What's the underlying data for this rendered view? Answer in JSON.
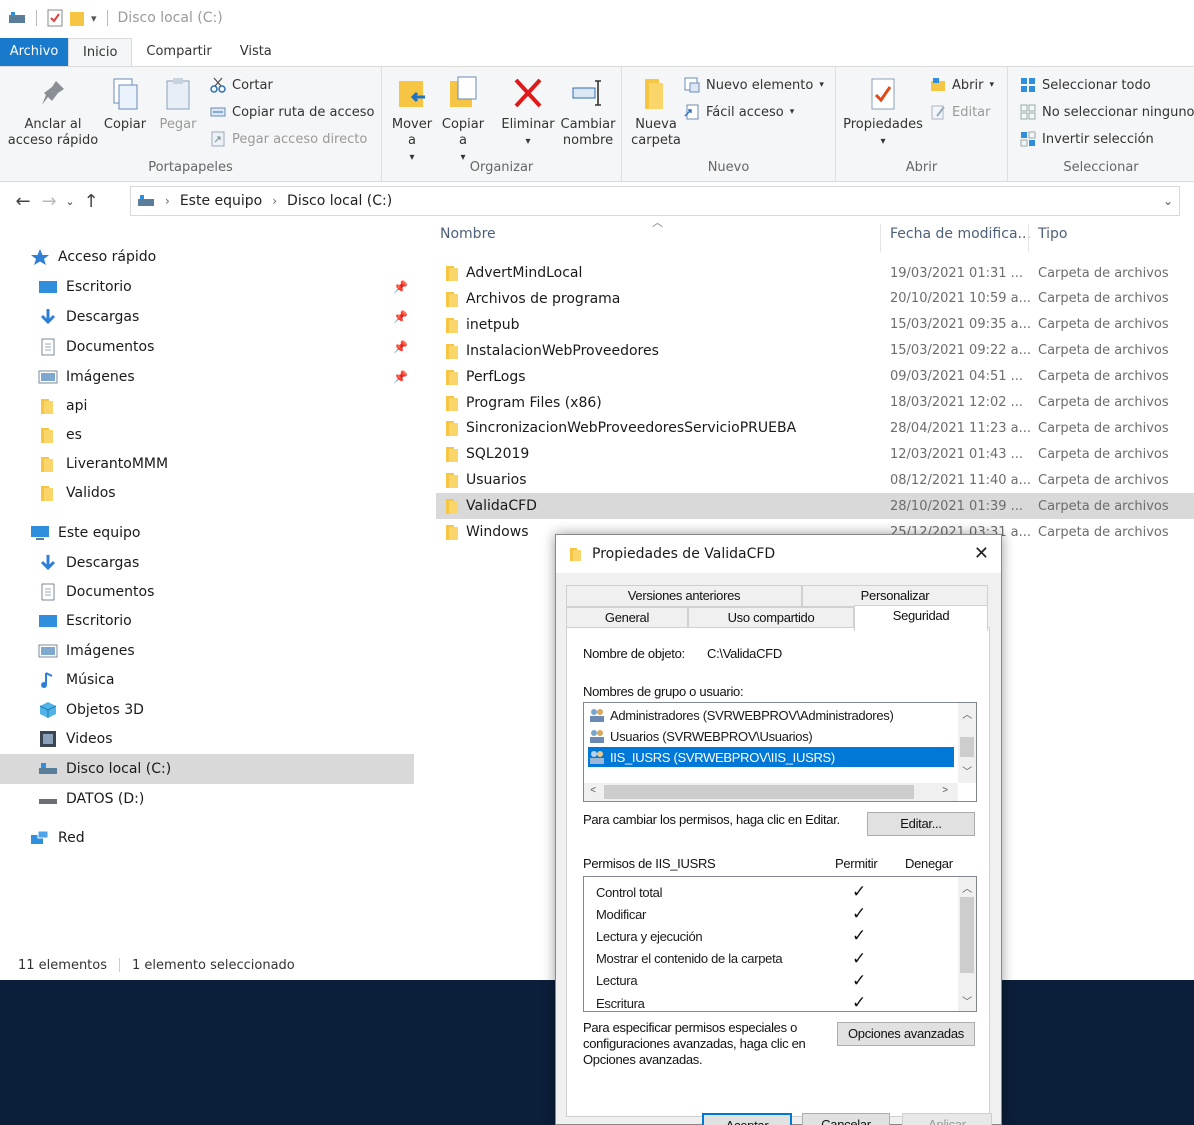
{
  "explorer": {
    "title": "Disco local (C:)",
    "menu_tabs": [
      "Archivo",
      "Inicio",
      "Compartir",
      "Vista"
    ],
    "ribbon": {
      "portapapeles": {
        "label": "Portapapeles",
        "anclar": "Anclar al acceso rápido",
        "copiar": "Copiar",
        "pegar": "Pegar",
        "cortar": "Cortar",
        "copiar_ruta": "Copiar ruta de acceso",
        "pegar_acceso": "Pegar acceso directo"
      },
      "organizar": {
        "label": "Organizar",
        "mover": "Mover a",
        "copiar_a": "Copiar a",
        "eliminar": "Eliminar",
        "cambiar_nombre": "Cambiar nombre"
      },
      "nuevo": {
        "label": "Nuevo",
        "nueva_carpeta": "Nueva carpeta",
        "nuevo_elemento": "Nuevo elemento",
        "facil_acceso": "Fácil acceso"
      },
      "abrir": {
        "label": "Abrir",
        "propiedades": "Propiedades",
        "abrir": "Abrir",
        "editar": "Editar"
      },
      "seleccionar": {
        "label": "Seleccionar",
        "todo": "Seleccionar todo",
        "ninguno": "No seleccionar ninguno",
        "invertir": "Invertir selección"
      }
    },
    "breadcrumb": [
      "Este equipo",
      "Disco local (C:)"
    ],
    "nav": {
      "quick_access": "Acceso rápido",
      "quick_items": [
        "Escritorio",
        "Descargas",
        "Documentos",
        "Imágenes",
        "api",
        "es",
        "LiverantoMMM",
        "Validos"
      ],
      "this_pc": "Este equipo",
      "pc_items": [
        "Descargas",
        "Documentos",
        "Escritorio",
        "Imágenes",
        "Música",
        "Objetos 3D",
        "Videos",
        "Disco local (C:)",
        "DATOS (D:)"
      ],
      "network": "Red"
    },
    "columns": {
      "name": "Nombre",
      "date": "Fecha de modifica...",
      "type": "Tipo"
    },
    "files": [
      {
        "name": "AdvertMindLocal",
        "date": "19/03/2021 01:31 ...",
        "type": "Carpeta de archivos"
      },
      {
        "name": "Archivos de programa",
        "date": "20/10/2021 10:59 a...",
        "type": "Carpeta de archivos"
      },
      {
        "name": "inetpub",
        "date": "15/03/2021 09:35 a...",
        "type": "Carpeta de archivos"
      },
      {
        "name": "InstalacionWebProveedores",
        "date": "15/03/2021 09:22 a...",
        "type": "Carpeta de archivos"
      },
      {
        "name": "PerfLogs",
        "date": "09/03/2021 04:51 ...",
        "type": "Carpeta de archivos"
      },
      {
        "name": "Program Files (x86)",
        "date": "18/03/2021 12:02 ...",
        "type": "Carpeta de archivos"
      },
      {
        "name": "SincronizacionWebProveedoresServicioPRUEBA",
        "date": "28/04/2021 11:23 a...",
        "type": "Carpeta de archivos"
      },
      {
        "name": "SQL2019",
        "date": "12/03/2021 01:43 ...",
        "type": "Carpeta de archivos"
      },
      {
        "name": "Usuarios",
        "date": "08/12/2021 11:40 a...",
        "type": "Carpeta de archivos"
      },
      {
        "name": "ValidaCFD",
        "date": "28/10/2021 01:39 ...",
        "type": "Carpeta de archivos"
      },
      {
        "name": "Windows",
        "date": "25/12/2021 03:31 a...",
        "type": "Carpeta de archivos"
      }
    ],
    "status": {
      "count": "11 elementos",
      "selected": "1 elemento seleccionado"
    }
  },
  "dialog": {
    "title": "Propiedades de ValidaCFD",
    "tabs_top": [
      "Versiones anteriores",
      "Personalizar"
    ],
    "tabs_bottom": [
      "General",
      "Uso compartido",
      "Seguridad"
    ],
    "object_name_label": "Nombre de objeto:",
    "object_name_value": "C:\\ValidaCFD",
    "groups_label": "Nombres de grupo o usuario:",
    "groups": [
      "Administradores (SVRWEBPROV\\Administradores)",
      "Usuarios (SVRWEBPROV\\Usuarios)",
      "IIS_IUSRS (SVRWEBPROV\\IIS_IUSRS)"
    ],
    "change_hint": "Para cambiar los permisos, haga clic en Editar.",
    "edit_button": "Editar...",
    "perm_header": "Permisos de IIS_IUSRS",
    "allow_header": "Permitir",
    "deny_header": "Denegar",
    "permissions": [
      "Control total",
      "Modificar",
      "Lectura y ejecución",
      "Mostrar el contenido de la carpeta",
      "Lectura",
      "Escritura"
    ],
    "check_mark": "✓",
    "special_hint": "Para especificar permisos especiales o configuraciones avanzadas, haga clic en Opciones avanzadas.",
    "advanced_button": "Opciones avanzadas",
    "ok_button": "Aceptar",
    "cancel_button": "Cancelar",
    "apply_button": "Aplicar"
  }
}
